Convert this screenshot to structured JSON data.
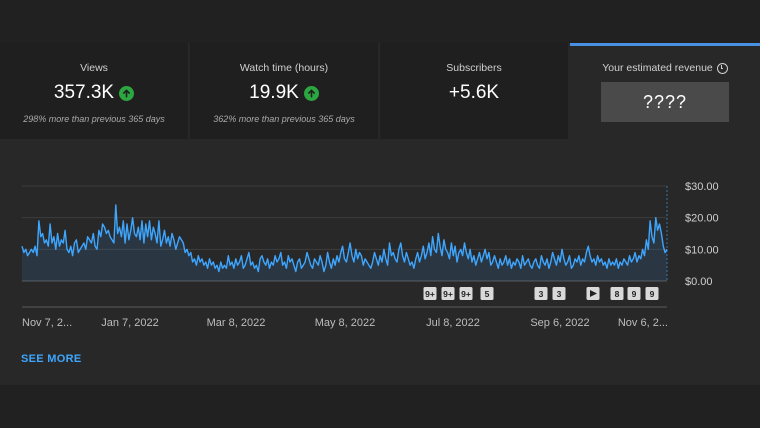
{
  "stats": {
    "views": {
      "label": "Views",
      "value": "357.3K",
      "comparison": "298% more than previous 365 days"
    },
    "watch_time": {
      "label": "Watch time (hours)",
      "value": "19.9K",
      "comparison": "362% more than previous 365 days"
    },
    "subscribers": {
      "label": "Subscribers",
      "value": "+5.6K"
    },
    "revenue": {
      "label": "Your estimated revenue",
      "value": "????"
    }
  },
  "chart_data": {
    "type": "area",
    "x_tick_labels": [
      "Nov 7, 2...",
      "Jan 7, 2022",
      "Mar 8, 2022",
      "May 8, 2022",
      "Jul 8, 2022",
      "Sep 6, 2022",
      "Nov 6, 2..."
    ],
    "y_tick_labels": [
      "$30.00",
      "$20.00",
      "$10.00",
      "$0.00"
    ],
    "ylim": [
      0,
      30
    ],
    "values": [
      11,
      9,
      10,
      8,
      9,
      10,
      9,
      11,
      8,
      19,
      14,
      15,
      12,
      13,
      11,
      18,
      12,
      14,
      10,
      15,
      11,
      13,
      12,
      16,
      10,
      9,
      11,
      8,
      12,
      13,
      9,
      10,
      11,
      12,
      10,
      14,
      13,
      12,
      15,
      11,
      10,
      16,
      14,
      18,
      17,
      15,
      16,
      14,
      13,
      12,
      24,
      15,
      17,
      14,
      19,
      12,
      18,
      13,
      16,
      20,
      15,
      14,
      17,
      13,
      19,
      12,
      18,
      14,
      19,
      13,
      17,
      15,
      12,
      19,
      11,
      13,
      16,
      12,
      14,
      11,
      15,
      13,
      10,
      12,
      14,
      13,
      12,
      9,
      10,
      8,
      9,
      6,
      7,
      5,
      8,
      6,
      7,
      5,
      6,
      4,
      7,
      5,
      6,
      4,
      5,
      3,
      6,
      4,
      5,
      4,
      8,
      5,
      6,
      4,
      7,
      5,
      6,
      8,
      4,
      5,
      7,
      9,
      5,
      6,
      4,
      5,
      3,
      7,
      8,
      6,
      5,
      7,
      4,
      6,
      5,
      8,
      6,
      7,
      9,
      5,
      6,
      4,
      8,
      6,
      7,
      5,
      3,
      6,
      7,
      4,
      5,
      6,
      9,
      7,
      5,
      4,
      7,
      6,
      5,
      8,
      6,
      3,
      5,
      9,
      6,
      4,
      7,
      5,
      8,
      6,
      9,
      11,
      7,
      6,
      9,
      12,
      8,
      6,
      10,
      7,
      9,
      8,
      5,
      7,
      6,
      5,
      4,
      6,
      9,
      7,
      5,
      8,
      6,
      10,
      7,
      5,
      12,
      8,
      9,
      7,
      6,
      10,
      12,
      8,
      6,
      9,
      7,
      5,
      6,
      4,
      7,
      9,
      6,
      8,
      11,
      7,
      9,
      12,
      8,
      14,
      10,
      9,
      15,
      11,
      8,
      13,
      10,
      9,
      7,
      12,
      8,
      11,
      6,
      9,
      10,
      8,
      12,
      9,
      7,
      10,
      6,
      8,
      5,
      7,
      9,
      6,
      8,
      10,
      7,
      9,
      5,
      6,
      8,
      6,
      4,
      7,
      5,
      6,
      8,
      5,
      7,
      4,
      6,
      5,
      7,
      6,
      4,
      8,
      5,
      6,
      7,
      5,
      4,
      6,
      7,
      5,
      4,
      8,
      6,
      5,
      7,
      4,
      6,
      9,
      7,
      5,
      8,
      6,
      10,
      7,
      5,
      6,
      8,
      4,
      5,
      7,
      6,
      8,
      5,
      7,
      6,
      9,
      11,
      8,
      6,
      7,
      5,
      8,
      6,
      7,
      5,
      6,
      4,
      7,
      5,
      6,
      5,
      7,
      4,
      6,
      5,
      7,
      6,
      5,
      8,
      6,
      7,
      9,
      6,
      8,
      7,
      10,
      8,
      13,
      10,
      19,
      14,
      12,
      20,
      16,
      18,
      15,
      11,
      9,
      10
    ]
  },
  "timeline_badges": [
    {
      "label": "9+",
      "type": "text"
    },
    {
      "label": "9+",
      "type": "text"
    },
    {
      "label": "9+",
      "type": "text"
    },
    {
      "label": "5",
      "type": "text"
    },
    {
      "label": "3",
      "type": "text"
    },
    {
      "label": "3",
      "type": "text"
    },
    {
      "label": "",
      "type": "play-icon"
    },
    {
      "label": "8",
      "type": "text"
    },
    {
      "label": "9",
      "type": "text"
    },
    {
      "label": "9",
      "type": "text"
    }
  ],
  "see_more": "SEE MORE",
  "colors": {
    "line": "#3ea6ff",
    "accent_bar": "#4a90e2",
    "positive": "#2ba640",
    "link": "#3ea6ff"
  }
}
